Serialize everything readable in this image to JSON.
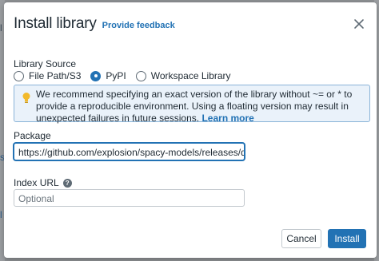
{
  "background": {
    "fragments": [
      "l",
      "s",
      "l"
    ]
  },
  "dialog": {
    "title": "Install library",
    "feedback_link": "Provide feedback",
    "library_source": {
      "label": "Library Source",
      "options": [
        "File Path/S3",
        "PyPI",
        "Workspace Library"
      ],
      "selected": "PyPI"
    },
    "info": {
      "text": "We recommend specifying an exact version of the library without ~= or * to provide a reproducible environment. Using a floating version may result in unexpected failures in future sessions.",
      "link": "Learn more"
    },
    "package": {
      "label": "Package",
      "value": "https://github.com/explosion/spacy-models/releases/downlo"
    },
    "index_url": {
      "label": "Index URL",
      "help": "?",
      "placeholder": "Optional"
    },
    "buttons": {
      "cancel": "Cancel",
      "install": "Install"
    }
  },
  "colors": {
    "accent": "#2272b4",
    "info_bg": "#eaf2fa",
    "info_border": "#8ab4d8",
    "bulb": "#f2b92b",
    "backdrop": "#8d9093"
  }
}
